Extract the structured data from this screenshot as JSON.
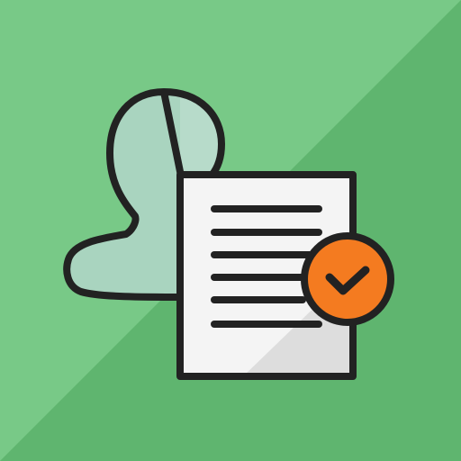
{
  "icon": {
    "subject": "user-profile-document-approved",
    "parts": [
      "user-silhouette-icon",
      "document-icon",
      "checkmark-badge-icon"
    ]
  },
  "colors": {
    "background_light": "#78c987",
    "background_dark": "#5fb56f",
    "user_fill": "#a9d4bf",
    "user_highlight": "#c2e0d4",
    "document_fill": "#f4f4f4",
    "document_shadow": "#dddddd",
    "badge_fill": "#f47b20",
    "outline": "#222222"
  }
}
